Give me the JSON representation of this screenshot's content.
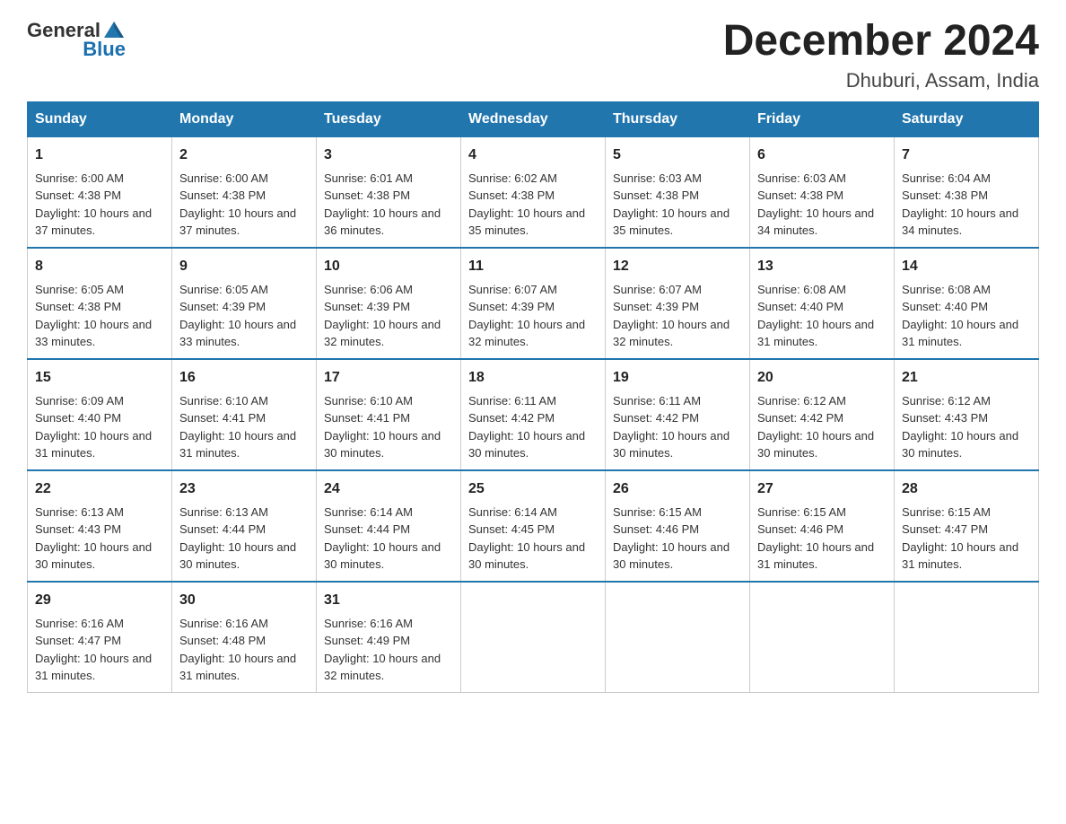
{
  "header": {
    "logo_general": "General",
    "logo_blue": "Blue",
    "month": "December 2024",
    "location": "Dhuburi, Assam, India"
  },
  "days_of_week": [
    "Sunday",
    "Monday",
    "Tuesday",
    "Wednesday",
    "Thursday",
    "Friday",
    "Saturday"
  ],
  "weeks": [
    [
      {
        "day": "1",
        "sunrise": "6:00 AM",
        "sunset": "4:38 PM",
        "daylight": "10 hours and 37 minutes."
      },
      {
        "day": "2",
        "sunrise": "6:00 AM",
        "sunset": "4:38 PM",
        "daylight": "10 hours and 37 minutes."
      },
      {
        "day": "3",
        "sunrise": "6:01 AM",
        "sunset": "4:38 PM",
        "daylight": "10 hours and 36 minutes."
      },
      {
        "day": "4",
        "sunrise": "6:02 AM",
        "sunset": "4:38 PM",
        "daylight": "10 hours and 35 minutes."
      },
      {
        "day": "5",
        "sunrise": "6:03 AM",
        "sunset": "4:38 PM",
        "daylight": "10 hours and 35 minutes."
      },
      {
        "day": "6",
        "sunrise": "6:03 AM",
        "sunset": "4:38 PM",
        "daylight": "10 hours and 34 minutes."
      },
      {
        "day": "7",
        "sunrise": "6:04 AM",
        "sunset": "4:38 PM",
        "daylight": "10 hours and 34 minutes."
      }
    ],
    [
      {
        "day": "8",
        "sunrise": "6:05 AM",
        "sunset": "4:38 PM",
        "daylight": "10 hours and 33 minutes."
      },
      {
        "day": "9",
        "sunrise": "6:05 AM",
        "sunset": "4:39 PM",
        "daylight": "10 hours and 33 minutes."
      },
      {
        "day": "10",
        "sunrise": "6:06 AM",
        "sunset": "4:39 PM",
        "daylight": "10 hours and 32 minutes."
      },
      {
        "day": "11",
        "sunrise": "6:07 AM",
        "sunset": "4:39 PM",
        "daylight": "10 hours and 32 minutes."
      },
      {
        "day": "12",
        "sunrise": "6:07 AM",
        "sunset": "4:39 PM",
        "daylight": "10 hours and 32 minutes."
      },
      {
        "day": "13",
        "sunrise": "6:08 AM",
        "sunset": "4:40 PM",
        "daylight": "10 hours and 31 minutes."
      },
      {
        "day": "14",
        "sunrise": "6:08 AM",
        "sunset": "4:40 PM",
        "daylight": "10 hours and 31 minutes."
      }
    ],
    [
      {
        "day": "15",
        "sunrise": "6:09 AM",
        "sunset": "4:40 PM",
        "daylight": "10 hours and 31 minutes."
      },
      {
        "day": "16",
        "sunrise": "6:10 AM",
        "sunset": "4:41 PM",
        "daylight": "10 hours and 31 minutes."
      },
      {
        "day": "17",
        "sunrise": "6:10 AM",
        "sunset": "4:41 PM",
        "daylight": "10 hours and 30 minutes."
      },
      {
        "day": "18",
        "sunrise": "6:11 AM",
        "sunset": "4:42 PM",
        "daylight": "10 hours and 30 minutes."
      },
      {
        "day": "19",
        "sunrise": "6:11 AM",
        "sunset": "4:42 PM",
        "daylight": "10 hours and 30 minutes."
      },
      {
        "day": "20",
        "sunrise": "6:12 AM",
        "sunset": "4:42 PM",
        "daylight": "10 hours and 30 minutes."
      },
      {
        "day": "21",
        "sunrise": "6:12 AM",
        "sunset": "4:43 PM",
        "daylight": "10 hours and 30 minutes."
      }
    ],
    [
      {
        "day": "22",
        "sunrise": "6:13 AM",
        "sunset": "4:43 PM",
        "daylight": "10 hours and 30 minutes."
      },
      {
        "day": "23",
        "sunrise": "6:13 AM",
        "sunset": "4:44 PM",
        "daylight": "10 hours and 30 minutes."
      },
      {
        "day": "24",
        "sunrise": "6:14 AM",
        "sunset": "4:44 PM",
        "daylight": "10 hours and 30 minutes."
      },
      {
        "day": "25",
        "sunrise": "6:14 AM",
        "sunset": "4:45 PM",
        "daylight": "10 hours and 30 minutes."
      },
      {
        "day": "26",
        "sunrise": "6:15 AM",
        "sunset": "4:46 PM",
        "daylight": "10 hours and 30 minutes."
      },
      {
        "day": "27",
        "sunrise": "6:15 AM",
        "sunset": "4:46 PM",
        "daylight": "10 hours and 31 minutes."
      },
      {
        "day": "28",
        "sunrise": "6:15 AM",
        "sunset": "4:47 PM",
        "daylight": "10 hours and 31 minutes."
      }
    ],
    [
      {
        "day": "29",
        "sunrise": "6:16 AM",
        "sunset": "4:47 PM",
        "daylight": "10 hours and 31 minutes."
      },
      {
        "day": "30",
        "sunrise": "6:16 AM",
        "sunset": "4:48 PM",
        "daylight": "10 hours and 31 minutes."
      },
      {
        "day": "31",
        "sunrise": "6:16 AM",
        "sunset": "4:49 PM",
        "daylight": "10 hours and 32 minutes."
      },
      null,
      null,
      null,
      null
    ]
  ]
}
